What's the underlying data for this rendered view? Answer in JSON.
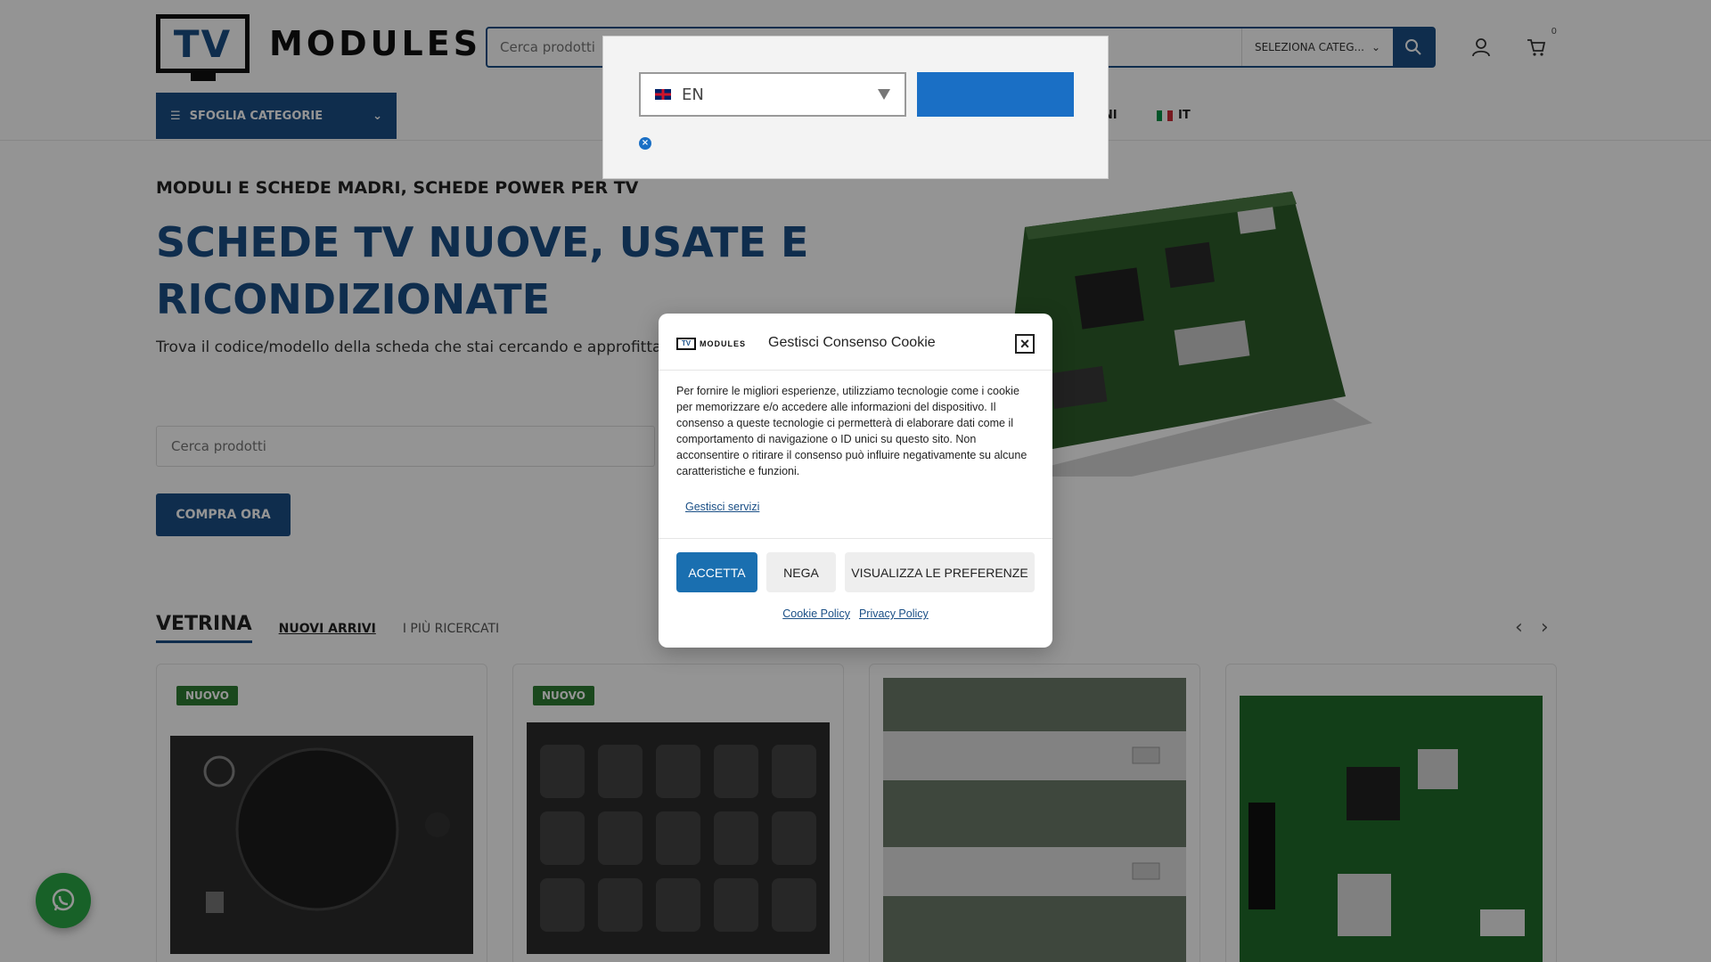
{
  "header": {
    "logo_tv": "TV",
    "logo_text": "MODULES",
    "search_placeholder": "Cerca prodotti",
    "category_select": "SELEZIONA CATEG...",
    "cart_count": "0"
  },
  "nav": {
    "browse_label": "SFOGLIA CATEGORIE",
    "partial_link": "IONI",
    "lang_link": "IT"
  },
  "hero": {
    "subtitle": "MODULI E SCHEDE MADRI, SCHEDE POWER PER TV",
    "title": "SCHEDE TV NUOVE, USATE E RICONDIZIONATE",
    "description": "Trova il codice/modello della scheda che stai cercando e approfitta de",
    "search_placeholder": "Cerca prodotti",
    "cta": "COMPRA ORA"
  },
  "showcase": {
    "title": "VETRINA",
    "tabs": [
      "NUOVI ARRIVI",
      "I PIÙ RICERCATI"
    ],
    "products": [
      {
        "badge": "NUOVO",
        "icon": "remote-control-image"
      },
      {
        "badge": "NUOVO",
        "icon": "remote-control-image"
      },
      {
        "badge": "",
        "icon": "led-strip-image"
      },
      {
        "badge": "",
        "icon": "mainboard-image"
      }
    ]
  },
  "language_popup": {
    "selected": "EN",
    "flag": "uk-flag-icon"
  },
  "cookie": {
    "logo_tv": "TV",
    "logo_text": "MODULES",
    "title": "Gestisci Consenso Cookie",
    "body": "Per fornire le migliori esperienze, utilizziamo tecnologie come i cookie per memorizzare e/o accedere alle informazioni del dispositivo. Il consenso a queste tecnologie ci permetterà di elaborare dati come il comportamento di navigazione o ID unici su questo sito. Non acconsentire o ritirare il consenso può influire negativamente su alcune caratteristiche e funzioni.",
    "manage_services": "Gestisci servizi",
    "accept": "ACCETTA",
    "deny": "NEGA",
    "preferences": "VISUALIZZA LE PREFERENZE",
    "cookie_policy": "Cookie Policy",
    "privacy_policy": "Privacy Policy"
  },
  "colors": {
    "brand_blue": "#1a4f86",
    "button_blue": "#1a6fb0",
    "badge_green": "#2e7d32",
    "whatsapp_green": "#2aa745"
  }
}
